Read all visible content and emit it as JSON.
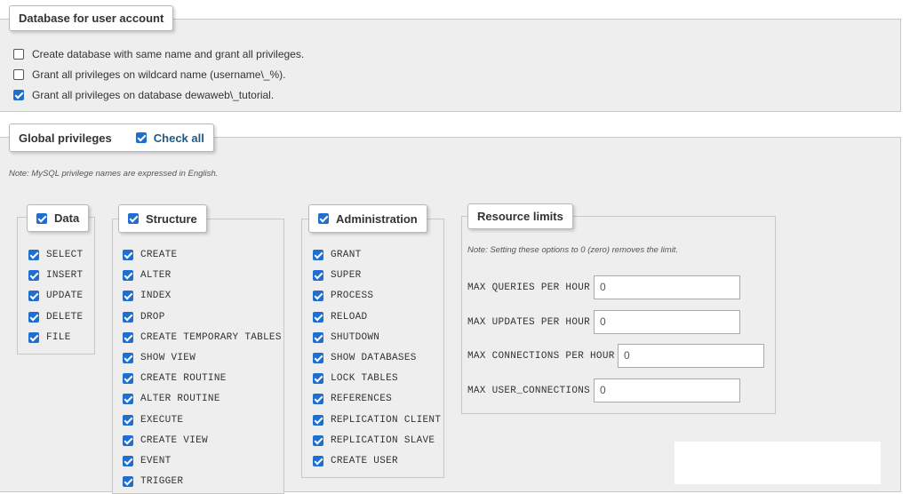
{
  "db_section": {
    "legend": "Database for user account",
    "options": [
      {
        "label": "Create database with same name and grant all privileges.",
        "checked": false
      },
      {
        "label": "Grant all privileges on wildcard name (username\\_%).",
        "checked": false
      },
      {
        "label": "Grant all privileges on database dewaweb\\_tutorial.",
        "checked": true
      }
    ]
  },
  "global": {
    "legend": "Global privileges",
    "check_all_label": "Check all",
    "note": "Note: MySQL privilege names are expressed in English."
  },
  "groups": {
    "data": {
      "label": "Data",
      "items": [
        "SELECT",
        "INSERT",
        "UPDATE",
        "DELETE",
        "FILE"
      ]
    },
    "structure": {
      "label": "Structure",
      "items": [
        "CREATE",
        "ALTER",
        "INDEX",
        "DROP",
        "CREATE TEMPORARY TABLES",
        "SHOW VIEW",
        "CREATE ROUTINE",
        "ALTER ROUTINE",
        "EXECUTE",
        "CREATE VIEW",
        "EVENT",
        "TRIGGER"
      ]
    },
    "administration": {
      "label": "Administration",
      "items": [
        "GRANT",
        "SUPER",
        "PROCESS",
        "RELOAD",
        "SHUTDOWN",
        "SHOW DATABASES",
        "LOCK TABLES",
        "REFERENCES",
        "REPLICATION CLIENT",
        "REPLICATION SLAVE",
        "CREATE USER"
      ]
    }
  },
  "resource": {
    "legend": "Resource limits",
    "note": "Note: Setting these options to 0 (zero) removes the limit.",
    "limits": [
      {
        "label": "MAX QUERIES PER HOUR",
        "value": "0"
      },
      {
        "label": "MAX UPDATES PER HOUR",
        "value": "0"
      },
      {
        "label": "MAX CONNECTIONS PER HOUR",
        "value": "0"
      },
      {
        "label": "MAX USER_CONNECTIONS",
        "value": "0"
      }
    ]
  },
  "colors": {
    "checkbox": "#1f6fd0",
    "panel": "#eeeeee",
    "link": "#235a81"
  }
}
